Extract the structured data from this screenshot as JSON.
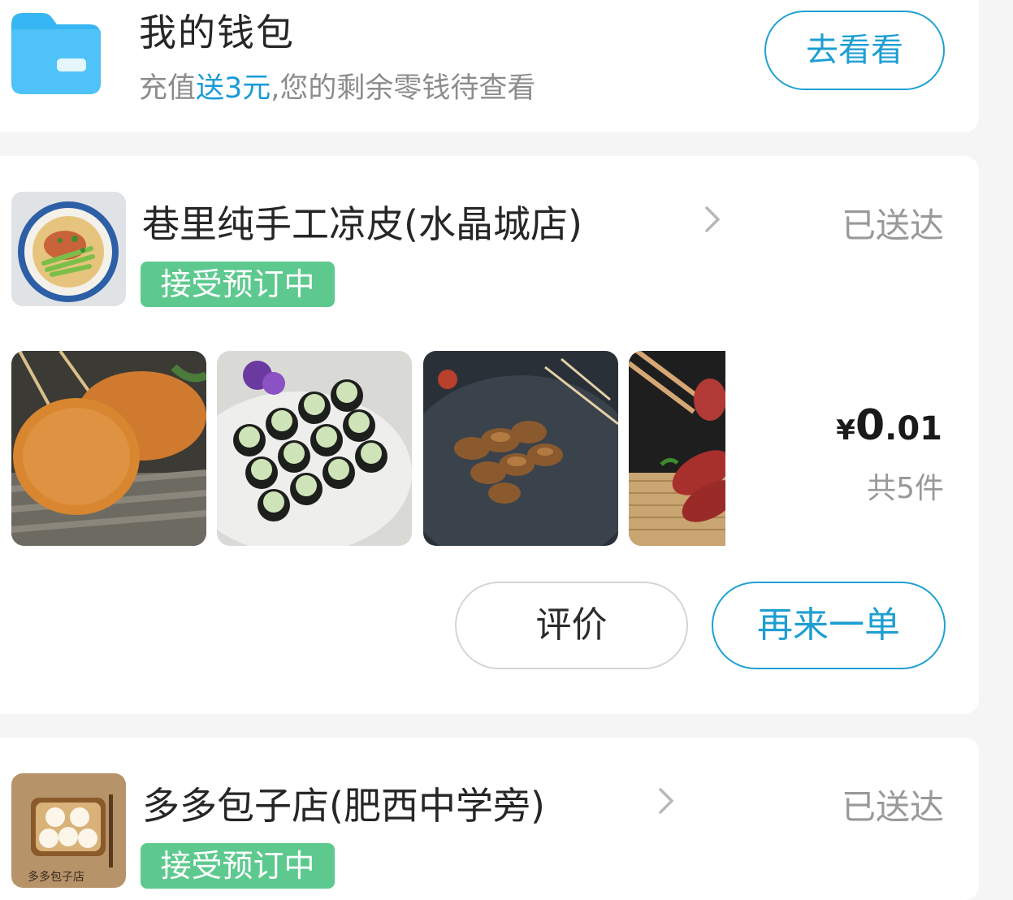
{
  "wallet": {
    "title": "我的钱包",
    "subtitle_prefix": "充值",
    "subtitle_highlight": "送3元",
    "subtitle_suffix": ",您的剩余零钱待查看",
    "button_label": "去看看",
    "accent_color": "#1a9bd7",
    "icon": "wallet-folder-icon"
  },
  "orders": [
    {
      "shop_name": "巷里纯手工凉皮(水晶城店)",
      "status": "已送达",
      "tag": "接受预订中",
      "items": [
        {
          "icon": "fried-chicken-cutlet-skewer-image"
        },
        {
          "icon": "seaweed-rice-roll-skewer-image"
        },
        {
          "icon": "grilled-meat-skewer-image"
        },
        {
          "icon": "sausage-image"
        }
      ],
      "price_currency": "¥",
      "price_integer": "0",
      "price_decimal": ".01",
      "count": "共5件",
      "actions": {
        "review": "评价",
        "reorder": "再来一单"
      }
    },
    {
      "shop_name": "多多包子店(肥西中学旁)",
      "status": "已送达",
      "tag": "接受预订中",
      "logo_text": "多多包子店"
    }
  ],
  "colors": {
    "tag_green": "#5dc98e",
    "button_blue": "#1ea1d3",
    "status_gray": "#999999"
  }
}
